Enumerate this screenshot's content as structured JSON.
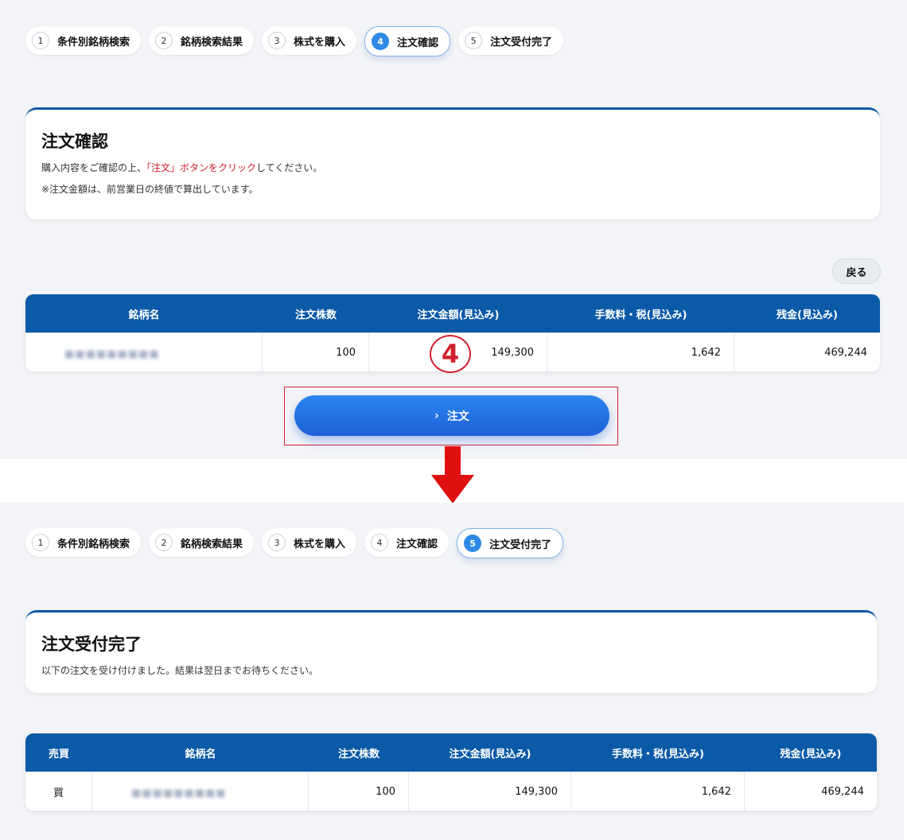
{
  "top": {
    "steps": [
      {
        "num": "1",
        "label": "条件別銘柄検索"
      },
      {
        "num": "2",
        "label": "銘柄検索結果"
      },
      {
        "num": "3",
        "label": "株式を購入"
      },
      {
        "num": "4",
        "label": "注文確認",
        "active": true
      },
      {
        "num": "5",
        "label": "注文受付完了"
      }
    ],
    "card": {
      "title": "注文確認",
      "line1_prefix": "購入内容をご確認の上、",
      "line1_highlight": "「注文」ボタンをクリック",
      "line1_suffix": "してください。",
      "line2": "※注文金額は、前営業日の終値で算出しています。"
    },
    "back_label": "戻る",
    "table": {
      "headers": [
        "銘柄名",
        "注文株数",
        "注文金額(見込み)",
        "手数料・税(見込み)",
        "残金(見込み)"
      ],
      "row": {
        "name": "　　 ■■■■■■■■■",
        "shares": "100",
        "amount": "149,300",
        "fee": "1,642",
        "balance": "469,244"
      }
    },
    "marker": "4",
    "order_button": {
      "icon": "›",
      "label": "注文"
    }
  },
  "bottom": {
    "steps": [
      {
        "num": "1",
        "label": "条件別銘柄検索"
      },
      {
        "num": "2",
        "label": "銘柄検索結果"
      },
      {
        "num": "3",
        "label": "株式を購入"
      },
      {
        "num": "4",
        "label": "注文確認"
      },
      {
        "num": "5",
        "label": "注文受付完了",
        "active": true
      }
    ],
    "card": {
      "title": "注文受付完了",
      "line1": "以下の注文を受け付けました。結果は翌日までお待ちください。"
    },
    "table": {
      "headers": [
        "売買",
        "銘柄名",
        "注文株数",
        "注文金額(見込み)",
        "手数料・税(見込み)",
        "残金(見込み)"
      ],
      "row": {
        "side": "買",
        "name": "　　 ■■■■■■■■■",
        "shares": "100",
        "amount": "149,300",
        "fee": "1,642",
        "balance": "469,244"
      }
    }
  },
  "colors": {
    "accent": "#0b5aa7",
    "button": "#2a86f0",
    "red": "#d1202f"
  }
}
